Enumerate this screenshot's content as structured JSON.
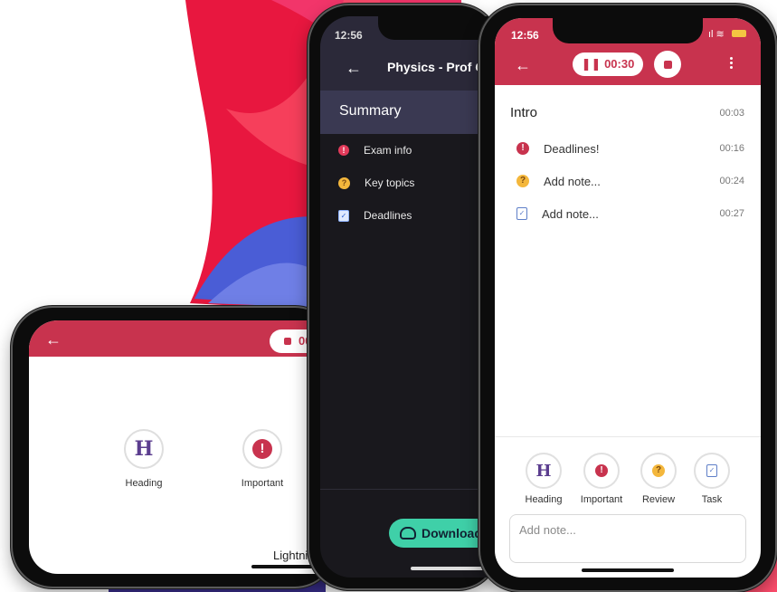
{
  "colors": {
    "brand_red": "#c8334e",
    "dark_bg": "#19181d",
    "dark_header": "#2b2939",
    "summary_bg": "#3a3952",
    "download_green": "#3fd0a8",
    "heading_purple": "#5b3d8f"
  },
  "landscape_phone": {
    "timer_partial": "00",
    "tools": {
      "heading_letter": "H",
      "heading_label": "Heading",
      "important_label": "Important"
    },
    "lightning_label": "Lightning"
  },
  "middle_phone": {
    "status_time": "12:56",
    "title": "Physics - Prof C",
    "summary_title": "Summary",
    "items": [
      {
        "label": "Exam info",
        "icon": "important-icon"
      },
      {
        "label": "Key topics",
        "icon": "thinking-emoji-icon"
      },
      {
        "label": "Deadlines",
        "icon": "task-icon"
      }
    ],
    "download_label": "Download"
  },
  "right_phone": {
    "status_time": "12:56",
    "timer": "00:30",
    "intro": {
      "label": "Intro",
      "time": "00:03"
    },
    "notes": [
      {
        "label": "Deadlines!",
        "time": "00:16",
        "icon": "important-icon"
      },
      {
        "label": "Add note...",
        "time": "00:24",
        "icon": "thinking-emoji-icon"
      },
      {
        "label": "Add note...",
        "time": "00:27",
        "icon": "task-icon"
      }
    ],
    "tools": [
      {
        "label": "Heading"
      },
      {
        "label": "Important"
      },
      {
        "label": "Review"
      },
      {
        "label": "Task"
      }
    ],
    "heading_letter": "H",
    "note_placeholder": "Add note..."
  }
}
